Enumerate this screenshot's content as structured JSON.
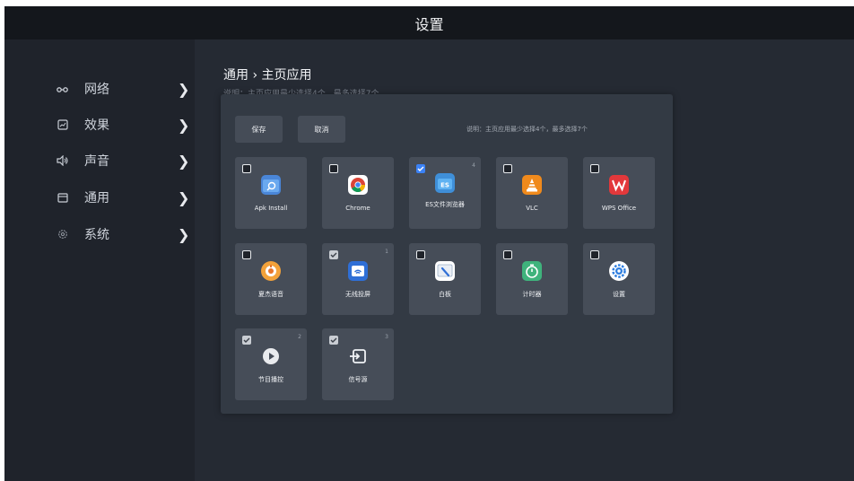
{
  "title": "设置",
  "sidebar": {
    "items": [
      {
        "label": "网络",
        "icon": "network-icon"
      },
      {
        "label": "效果",
        "icon": "picture-icon"
      },
      {
        "label": "声音",
        "icon": "speaker-icon"
      },
      {
        "label": "通用",
        "icon": "general-icon"
      },
      {
        "label": "系统",
        "icon": "system-gear-icon"
      }
    ],
    "chevron": "❯"
  },
  "breadcrumb": "通用 › 主页应用",
  "breadcrumb_sub": "说明：主页应用最少选择4个，最多选择7个",
  "dialog": {
    "save_label": "保存",
    "cancel_label": "取消",
    "note": "说明：主页应用最少选择4个，最多选择7个",
    "apps": [
      {
        "name": "Apk Install",
        "checked": false,
        "icon": "apk-install-icon"
      },
      {
        "name": "Chrome",
        "checked": false,
        "icon": "chrome-icon"
      },
      {
        "name": "ES文件浏览器",
        "checked": true,
        "order": "4",
        "icon": "es-file-explorer-icon"
      },
      {
        "name": "VLC",
        "checked": false,
        "icon": "vlc-icon"
      },
      {
        "name": "WPS Office",
        "checked": false,
        "icon": "wps-office-icon"
      },
      {
        "name": "夏杰语音",
        "checked": false,
        "icon": "voice-assistant-icon"
      },
      {
        "name": "无线投屏",
        "checked": true,
        "order": "1",
        "icon": "wireless-cast-icon"
      },
      {
        "name": "白板",
        "checked": false,
        "icon": "whiteboard-icon"
      },
      {
        "name": "计时器",
        "checked": false,
        "icon": "timer-icon"
      },
      {
        "name": "设置",
        "checked": false,
        "icon": "settings-icon"
      },
      {
        "name": "节目播控",
        "checked": true,
        "order": "2",
        "icon": "play-control-icon"
      },
      {
        "name": "信号源",
        "checked": true,
        "order": "3",
        "icon": "signal-source-icon"
      }
    ]
  },
  "colors": {
    "background": "#252a33",
    "sidebar": "#1f232b",
    "dialog": "#333a44",
    "tile": "#464d58",
    "checkbox_blue": "#3b82f6"
  }
}
